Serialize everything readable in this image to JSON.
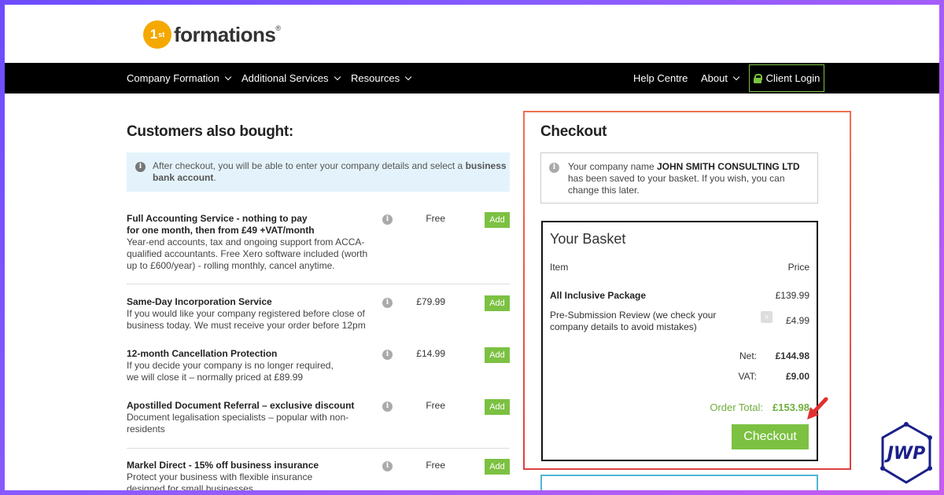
{
  "header": {
    "logo_badge": "1",
    "logo_badge_sup": "st",
    "logo_word": "formations",
    "logo_reg": "®"
  },
  "nav": {
    "left": [
      {
        "label": "Company Formation"
      },
      {
        "label": "Additional Services"
      },
      {
        "label": "Resources"
      }
    ],
    "right": [
      {
        "label": "Help Centre"
      },
      {
        "label": "About"
      }
    ],
    "client_login": "Client Login"
  },
  "upsell": {
    "title": "Customers also bought:",
    "info_pre": "After checkout, you will be able to enter your company details and select a ",
    "info_bold": "business bank account",
    "info_post": ".",
    "products": [
      {
        "title": "Full Accounting Service - nothing to pay for one month, then from £49 +VAT/month",
        "desc": "Year-end accounts, tax and ongoing support from ACCA-qualified accountants. Free Xero software included (worth up to £600/year) - rolling monthly, cancel anytime.",
        "price": "Free",
        "button": "Add"
      },
      {
        "title": "Same-Day Incorporation Service",
        "desc": "If you would like your company registered before close of business today. We must receive your order before 12pm",
        "price": "£79.99",
        "button": "Add"
      },
      {
        "title": "12-month Cancellation Protection",
        "desc": "If you decide your company is no longer required, we will close it – normally priced at £89.99",
        "price": "£14.99",
        "button": "Add"
      },
      {
        "title": "Apostilled Document Referral – exclusive discount",
        "desc": "Document legalisation specialists – popular with non-residents",
        "price": "Free",
        "button": "Add"
      },
      {
        "title": "Markel Direct - 15% off business insurance",
        "desc": "Protect your business with flexible insurance designed for small businesses",
        "price": "Free",
        "button": "Add"
      }
    ]
  },
  "checkout": {
    "title": "Checkout",
    "notice_pre": "Your company name ",
    "notice_company": "JOHN SMITH CONSULTING LTD",
    "notice_post": " has been saved to your basket. If you wish, you can change this later.",
    "basket_title": "Your Basket",
    "col_item": "Item",
    "col_price": "Price",
    "items": [
      {
        "name": "All Inclusive Package",
        "price": "£139.99"
      },
      {
        "name": "Pre-Submission Review (we check your company details to avoid mistakes)",
        "price": "£4.99",
        "remove": "x"
      }
    ],
    "net_label": "Net:",
    "net_value": "£144.98",
    "vat_label": "VAT:",
    "vat_value": "£9.00",
    "total_label": "Order Total:",
    "total_value": "£153.98",
    "button": "Checkout"
  },
  "watermark": "JWP",
  "colors": {
    "brand_green": "#7cc142",
    "logo_orange": "#f5a800",
    "highlight_red": "#e04040",
    "info_blue": "#e4f3fb"
  }
}
